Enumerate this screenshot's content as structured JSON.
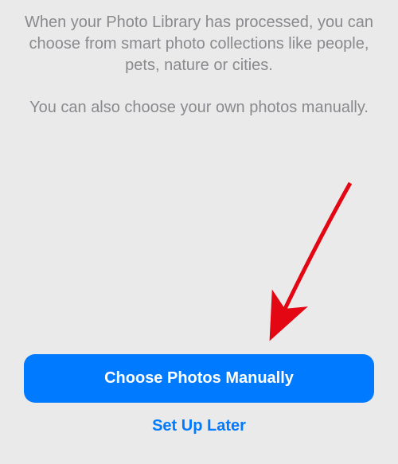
{
  "description": {
    "paragraph1": "When your Photo Library has processed, you can choose from smart photo collections like people, pets, nature or cities.",
    "paragraph2": "You can also choose your own photos manually."
  },
  "buttons": {
    "primary": "Choose Photos Manually",
    "secondary": "Set Up Later"
  },
  "annotation": {
    "arrow_color": "#e30613"
  }
}
